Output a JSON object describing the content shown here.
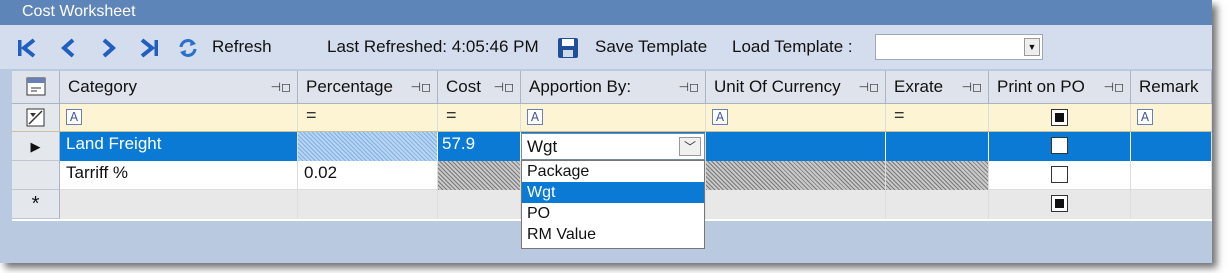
{
  "window": {
    "title": "Cost Worksheet"
  },
  "toolbar": {
    "refresh_label": "Refresh",
    "last_refreshed_label": "Last Refreshed: 4:05:46 PM",
    "save_template_label": "Save Template",
    "load_template_label": "Load Template :",
    "load_template_value": ""
  },
  "columns": [
    {
      "label": "Category"
    },
    {
      "label": "Percentage"
    },
    {
      "label": "Cost"
    },
    {
      "label": "Apportion By:"
    },
    {
      "label": "Unit Of Currency"
    },
    {
      "label": "Exrate"
    },
    {
      "label": "Print on PO"
    },
    {
      "label": "Remark"
    }
  ],
  "filter_row": {
    "category": "A",
    "percentage": "=",
    "cost": "=",
    "apportion": "A",
    "currency": "A",
    "exrate": "=",
    "print_on_po": true,
    "remark": "A"
  },
  "rows": [
    {
      "category": "Land Freight",
      "percentage": "",
      "cost": "57.9",
      "apportion": "Wgt",
      "currency": "",
      "exrate": "",
      "print_on_po": false,
      "remark": "",
      "selected": true
    },
    {
      "category": "Tarriff %",
      "percentage": "0.02",
      "cost": "",
      "apportion": "",
      "currency": "",
      "exrate": "",
      "print_on_po": false,
      "remark": ""
    },
    {
      "category": "",
      "percentage": "",
      "cost": "",
      "apportion": "",
      "currency": "",
      "exrate": "",
      "print_on_po": true,
      "remark": "",
      "new_row_marker": "*"
    }
  ],
  "apportion_dropdown": {
    "options": [
      "Package",
      "Wgt",
      "PO",
      "RM Value"
    ],
    "highlighted": "Wgt"
  },
  "colors": {
    "title_bar": "#5e85b8",
    "selection": "#0a7ad4",
    "filter_row": "#fdf4d4",
    "window_bg": "#b8c9e0"
  }
}
